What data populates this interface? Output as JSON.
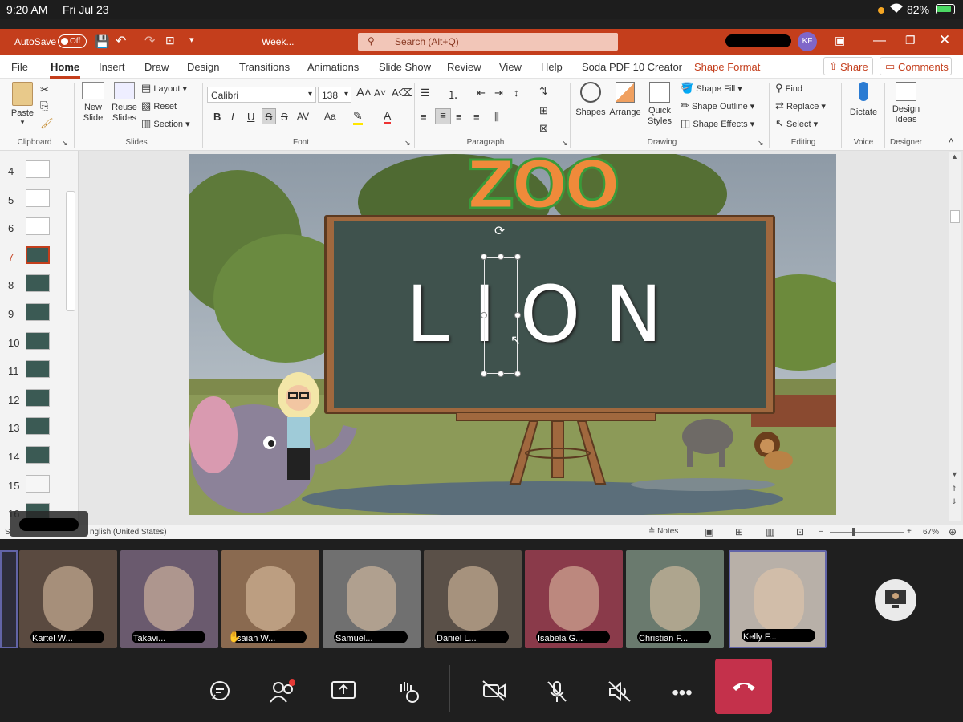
{
  "status_bar": {
    "time": "9:20 AM",
    "date": "Fri Jul 23",
    "battery": "82%"
  },
  "title_bar": {
    "autosave_label": "AutoSave",
    "autosave_state": "Off",
    "doc_title": "Week...",
    "search_placeholder": "Search (Alt+Q)",
    "user_initials": "KF"
  },
  "menu": {
    "tabs": [
      "File",
      "Home",
      "Insert",
      "Draw",
      "Design",
      "Transitions",
      "Animations",
      "Slide Show",
      "Review",
      "View",
      "Help",
      "Soda PDF 10 Creator",
      "Shape Format"
    ],
    "share": "Share",
    "comments": "Comments"
  },
  "ribbon": {
    "clipboard": {
      "paste": "Paste",
      "group": "Clipboard"
    },
    "slides": {
      "new_slide": "New Slide",
      "reuse_slides": "Reuse Slides",
      "layout": "Layout",
      "reset": "Reset",
      "section": "Section",
      "group": "Slides"
    },
    "font": {
      "family": "Calibri",
      "size": "138",
      "group": "Font",
      "bold": "B",
      "italic": "I",
      "underline": "U",
      "strike": "S",
      "spacing": "AV",
      "case": "Aa"
    },
    "paragraph": {
      "group": "Paragraph"
    },
    "drawing": {
      "shapes": "Shapes",
      "arrange": "Arrange",
      "quick_styles": "Quick Styles",
      "shape_fill": "Shape Fill",
      "shape_outline": "Shape Outline",
      "shape_effects": "Shape Effects",
      "group": "Drawing"
    },
    "editing": {
      "find": "Find",
      "replace": "Replace",
      "select": "Select",
      "group": "Editing"
    },
    "voice": {
      "dictate": "Dictate",
      "group": "Voice"
    },
    "designer": {
      "design_ideas": "Design Ideas",
      "group": "Designer"
    }
  },
  "thumbnails": [
    {
      "num": "4"
    },
    {
      "num": "5"
    },
    {
      "num": "6"
    },
    {
      "num": "7",
      "selected": true
    },
    {
      "num": "8"
    },
    {
      "num": "9"
    },
    {
      "num": "10"
    },
    {
      "num": "11"
    },
    {
      "num": "12"
    },
    {
      "num": "13"
    },
    {
      "num": "14"
    },
    {
      "num": "15"
    },
    {
      "num": "16"
    }
  ],
  "slide": {
    "logo": "ZOO",
    "word": "LION"
  },
  "statusbar": {
    "language": "nglish (United States)",
    "notes": "Notes",
    "zoom": "67%",
    "slide_prefix": "S"
  },
  "participants": [
    {
      "name": "Kartel W..."
    },
    {
      "name": "Takavi..."
    },
    {
      "name": "Isaiah W..."
    },
    {
      "name": "Samuel..."
    },
    {
      "name": "Daniel L..."
    },
    {
      "name": "Isabela G..."
    },
    {
      "name": "Christian F..."
    },
    {
      "name": "Kelly F..."
    }
  ],
  "colors": {
    "brand": "#c43e1c",
    "board": "#3f524d",
    "board_frame": "#a0683e",
    "leave": "#c4314b"
  }
}
